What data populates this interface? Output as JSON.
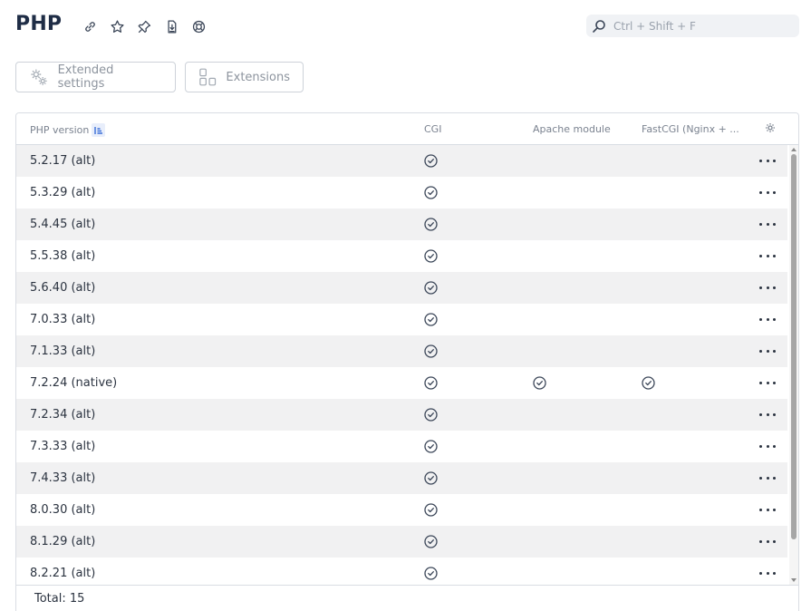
{
  "header": {
    "title": "PHP",
    "icons": [
      "link-icon",
      "star-icon",
      "pin-icon",
      "export-icon",
      "help-icon"
    ]
  },
  "search": {
    "placeholder": "Ctrl + Shift + F",
    "value": ""
  },
  "toolbar": {
    "extended_settings_label": "Extended settings",
    "extensions_label": "Extensions"
  },
  "table": {
    "columns": {
      "version": "PHP version",
      "cgi": "CGI",
      "apache": "Apache module",
      "fastcgi": "FastCGI (Nginx + ..."
    },
    "rows": [
      {
        "version": "5.2.17 (alt)",
        "cgi": true,
        "apache": false,
        "fastcgi": false
      },
      {
        "version": "5.3.29 (alt)",
        "cgi": true,
        "apache": false,
        "fastcgi": false
      },
      {
        "version": "5.4.45 (alt)",
        "cgi": true,
        "apache": false,
        "fastcgi": false
      },
      {
        "version": "5.5.38 (alt)",
        "cgi": true,
        "apache": false,
        "fastcgi": false
      },
      {
        "version": "5.6.40 (alt)",
        "cgi": true,
        "apache": false,
        "fastcgi": false
      },
      {
        "version": "7.0.33 (alt)",
        "cgi": true,
        "apache": false,
        "fastcgi": false
      },
      {
        "version": "7.1.33 (alt)",
        "cgi": true,
        "apache": false,
        "fastcgi": false
      },
      {
        "version": "7.2.24 (native)",
        "cgi": true,
        "apache": true,
        "fastcgi": true
      },
      {
        "version": "7.2.34 (alt)",
        "cgi": true,
        "apache": false,
        "fastcgi": false
      },
      {
        "version": "7.3.33 (alt)",
        "cgi": true,
        "apache": false,
        "fastcgi": false
      },
      {
        "version": "7.4.33 (alt)",
        "cgi": true,
        "apache": false,
        "fastcgi": false
      },
      {
        "version": "8.0.30 (alt)",
        "cgi": true,
        "apache": false,
        "fastcgi": false
      },
      {
        "version": "8.1.29 (alt)",
        "cgi": true,
        "apache": false,
        "fastcgi": false
      },
      {
        "version": "8.2.21 (alt)",
        "cgi": true,
        "apache": false,
        "fastcgi": false
      }
    ],
    "footer": "Total: 15"
  },
  "colors": {
    "title": "#1f2d46",
    "row_alt": "#f1f1f2",
    "sort_accent": "#3a6fd8"
  }
}
